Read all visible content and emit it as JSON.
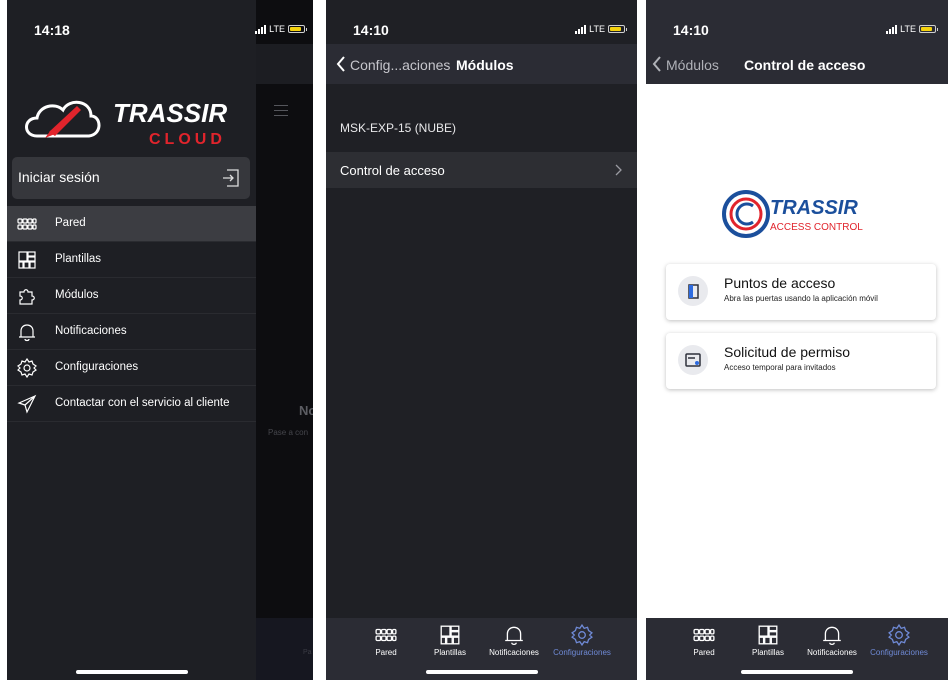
{
  "screen1": {
    "time": "14:18",
    "carrier": "LTE",
    "brand": {
      "name": "TRASSIR",
      "sub": "CLOUD"
    },
    "login_label": "Iniciar sesión",
    "menu": [
      {
        "label": "Pared",
        "icon": "wall-grid-icon",
        "active": true
      },
      {
        "label": "Plantillas",
        "icon": "templates-icon"
      },
      {
        "label": "Módulos",
        "icon": "puzzle-icon"
      },
      {
        "label": "Notificaciones",
        "icon": "bell-icon"
      },
      {
        "label": "Configuraciones",
        "icon": "gear-icon"
      },
      {
        "label": "Contactar con el servicio al cliente",
        "icon": "paper-plane-icon"
      }
    ],
    "background": {
      "heading": "No",
      "hint": "Pase a con",
      "nav_label": "Pa"
    }
  },
  "screen2": {
    "time": "14:10",
    "carrier": "LTE",
    "back_label": "Config...aciones",
    "title": "Módulos",
    "section": "MSK-EXP-15 (NUBE)",
    "row_label": "Control de acceso"
  },
  "screen3": {
    "time": "14:10",
    "carrier": "LTE",
    "back_label": "Módulos",
    "title": "Control de acceso",
    "brand": {
      "name": "TRASSIR",
      "sub": "ACCESS CONTROL"
    },
    "cards": [
      {
        "title": "Puntos de acceso",
        "subtitle": "Abra las puertas usando la aplicación móvil",
        "icon": "door-icon"
      },
      {
        "title": "Solicitud de permiso",
        "subtitle": "Acceso temporal para invitados",
        "icon": "permit-card-icon"
      }
    ]
  },
  "bottom_nav": [
    {
      "label": "Pared",
      "icon": "wall-grid-icon"
    },
    {
      "label": "Plantillas",
      "icon": "templates-icon"
    },
    {
      "label": "Notificaciones",
      "icon": "bell-icon"
    },
    {
      "label": "Configuraciones",
      "icon": "gear-icon",
      "selected": true
    }
  ],
  "colors": {
    "accent": "#6f8ad6",
    "brand_red": "#e1242c",
    "brand_blue": "#1b4f9c",
    "dark_bg": "#1e1f24",
    "bar_bg": "#2b2c34"
  }
}
